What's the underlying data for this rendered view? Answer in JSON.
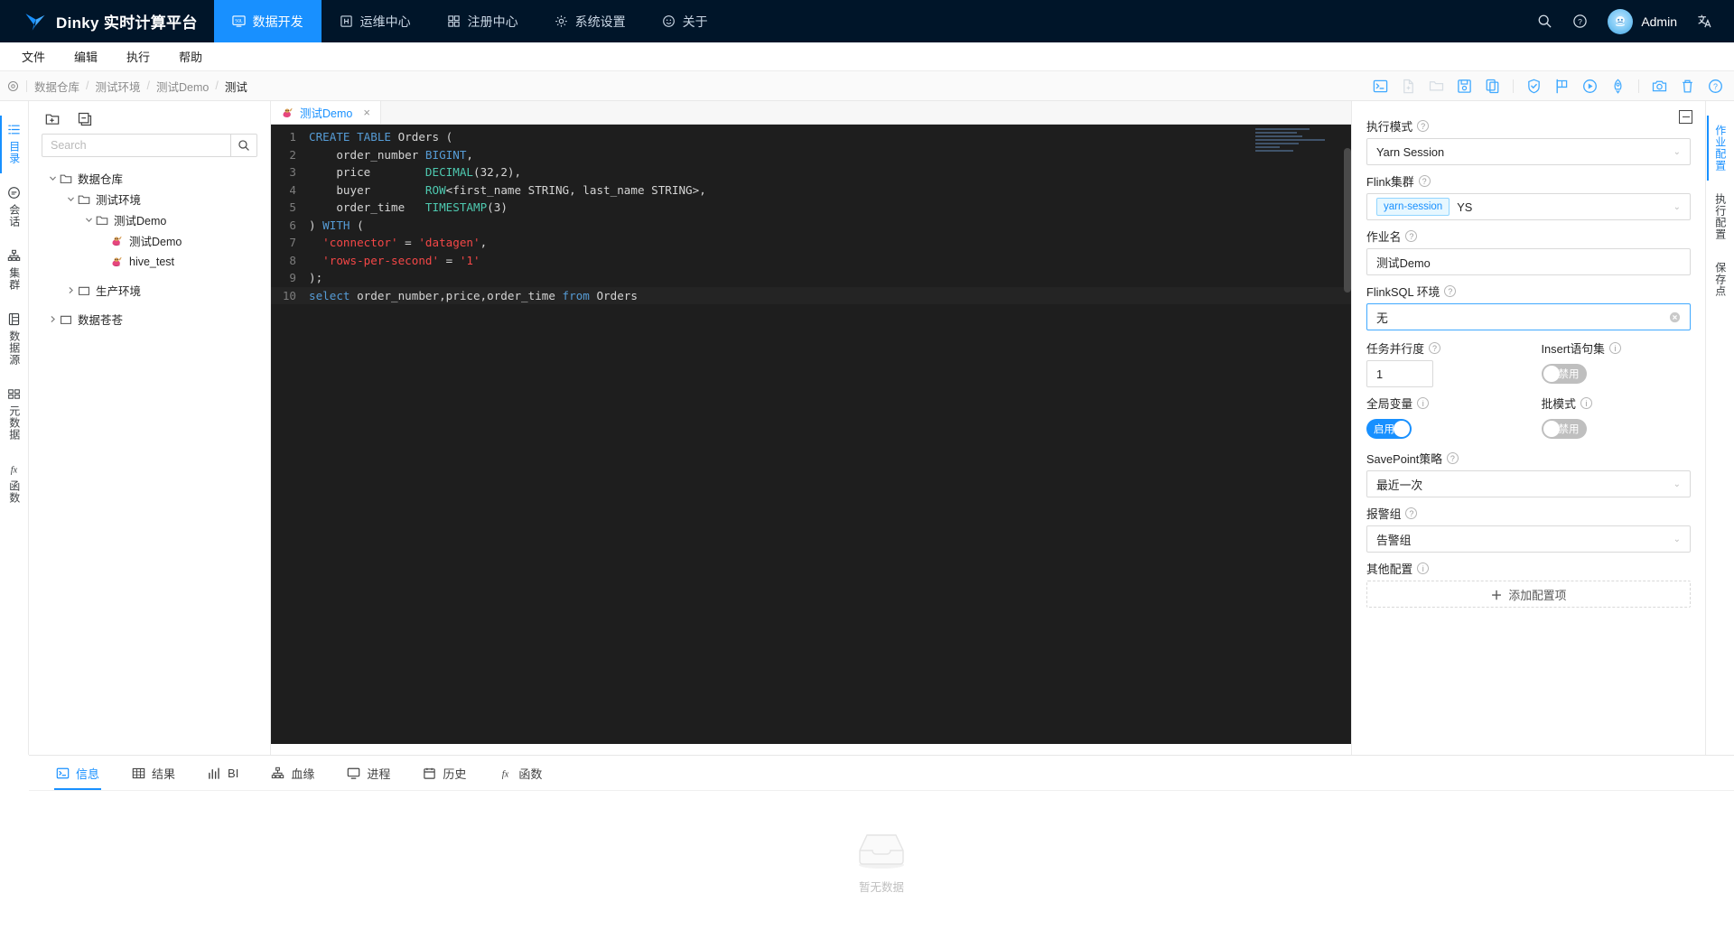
{
  "topnav": {
    "brand": "Dinky 实时计算平台",
    "items": [
      {
        "label": "数据开发",
        "icon": "sql-screen-icon",
        "active": true
      },
      {
        "label": "运维中心",
        "icon": "ops-icon",
        "active": false
      },
      {
        "label": "注册中心",
        "icon": "registry-icon",
        "active": false
      },
      {
        "label": "系统设置",
        "icon": "gear-icon",
        "active": false
      },
      {
        "label": "关于",
        "icon": "smile-icon",
        "active": false
      }
    ],
    "user": "Admin",
    "right_icons": [
      "search-icon",
      "question-circle-icon",
      "translate-icon"
    ],
    "accent": "#1890ff",
    "background": "#001529"
  },
  "menubar": {
    "items": [
      "文件",
      "编辑",
      "执行",
      "帮助"
    ]
  },
  "breadcrumb": {
    "target_icon": "target-icon",
    "path": [
      "数据仓库",
      "测试环境",
      "测试Demo",
      "测试"
    ],
    "separator": "/"
  },
  "toolbar": {
    "buttons": [
      {
        "name": "console-icon",
        "enabled": true
      },
      {
        "name": "new-file-icon",
        "enabled": false
      },
      {
        "name": "open-folder-icon",
        "enabled": false
      },
      {
        "name": "save-icon",
        "enabled": true
      },
      {
        "name": "copy-icon",
        "enabled": true
      },
      {
        "name": "check-shield-icon",
        "enabled": true
      },
      {
        "name": "flag-icon",
        "enabled": true
      },
      {
        "name": "play-circle-icon",
        "enabled": true
      },
      {
        "name": "rocket-icon",
        "enabled": true
      },
      {
        "name": "camera-icon",
        "enabled": true
      },
      {
        "name": "trash-icon",
        "enabled": true
      },
      {
        "name": "help-circle-icon",
        "enabled": true
      }
    ]
  },
  "left_rail": {
    "items": [
      {
        "label": "目录",
        "icon": "list-icon",
        "active": true
      },
      {
        "label": "会话",
        "icon": "chat-icon",
        "active": false
      },
      {
        "label": "集群",
        "icon": "cluster-icon",
        "active": false
      },
      {
        "label": "数据源",
        "icon": "database-icon",
        "active": false
      },
      {
        "label": "元数据",
        "icon": "metadata-icon",
        "active": false
      },
      {
        "label": "函数",
        "icon": "function-icon",
        "active": false
      }
    ]
  },
  "tree_panel": {
    "tools": [
      "new-folder-icon",
      "collapse-all-icon"
    ],
    "search_placeholder": "Search",
    "search_value": "",
    "nodes": [
      {
        "label": "数据仓库",
        "depth": 0,
        "caret": "down",
        "icon": "folder-icon"
      },
      {
        "label": "测试环境",
        "depth": 1,
        "caret": "down",
        "icon": "folder-icon"
      },
      {
        "label": "测试Demo",
        "depth": 2,
        "caret": "down",
        "icon": "folder-icon"
      },
      {
        "label": "测试Demo",
        "depth": 3,
        "caret": "none",
        "icon": "flink-task-icon"
      },
      {
        "label": "hive_test",
        "depth": 3,
        "caret": "none",
        "icon": "flink-task-icon"
      },
      {
        "label": "生产环境",
        "depth": 1,
        "caret": "right",
        "icon": "folder-icon"
      },
      {
        "label": "数据苍苍",
        "depth": 0,
        "caret": "right",
        "icon": "folder-icon"
      }
    ]
  },
  "editor": {
    "tab": {
      "label": "测试Demo",
      "icon": "flink-task-icon",
      "close": "×"
    },
    "lines": [
      {
        "no": "1",
        "tokens": [
          {
            "t": "CREATE TABLE ",
            "c": "k"
          },
          {
            "t": "Orders (",
            "c": ""
          }
        ]
      },
      {
        "no": "2",
        "tokens": [
          {
            "t": "    order_number ",
            "c": ""
          },
          {
            "t": "BIGINT",
            "c": "k"
          },
          {
            "t": ",",
            "c": ""
          }
        ]
      },
      {
        "no": "3",
        "tokens": [
          {
            "t": "    price        ",
            "c": ""
          },
          {
            "t": "DECIMAL",
            "c": "t"
          },
          {
            "t": "(32,2),",
            "c": ""
          }
        ]
      },
      {
        "no": "4",
        "tokens": [
          {
            "t": "    buyer        ",
            "c": ""
          },
          {
            "t": "ROW",
            "c": "t"
          },
          {
            "t": "<first_name STRING, last_name STRING>,",
            "c": ""
          }
        ]
      },
      {
        "no": "5",
        "tokens": [
          {
            "t": "    order_time   ",
            "c": ""
          },
          {
            "t": "TIMESTAMP",
            "c": "t"
          },
          {
            "t": "(3)",
            "c": ""
          }
        ]
      },
      {
        "no": "6",
        "tokens": [
          {
            "t": ") ",
            "c": ""
          },
          {
            "t": "WITH",
            "c": "k"
          },
          {
            "t": " (",
            "c": ""
          }
        ]
      },
      {
        "no": "7",
        "tokens": [
          {
            "t": "  ",
            "c": ""
          },
          {
            "t": "'connector'",
            "c": "r"
          },
          {
            "t": " = ",
            "c": ""
          },
          {
            "t": "'datagen'",
            "c": "r"
          },
          {
            "t": ",",
            "c": ""
          }
        ]
      },
      {
        "no": "8",
        "tokens": [
          {
            "t": "  ",
            "c": ""
          },
          {
            "t": "'rows-per-second'",
            "c": "r"
          },
          {
            "t": " = ",
            "c": ""
          },
          {
            "t": "'1'",
            "c": "r"
          }
        ]
      },
      {
        "no": "9",
        "tokens": [
          {
            "t": ");",
            "c": ""
          }
        ]
      },
      {
        "no": "10",
        "tokens": [
          {
            "t": "select",
            "c": "k"
          },
          {
            "t": " order_number,price,order_time ",
            "c": ""
          },
          {
            "t": "from",
            "c": "k"
          },
          {
            "t": " Orders",
            "c": ""
          }
        ]
      }
    ]
  },
  "config": {
    "fields": {
      "exec_mode_label": "执行模式",
      "exec_mode_value": "Yarn Session",
      "cluster_label": "Flink集群",
      "cluster_tag": "yarn-session",
      "cluster_value": "YS",
      "job_name_label": "作业名",
      "job_name_value": "测试Demo",
      "flinksql_env_label": "FlinkSQL 环境",
      "flinksql_env_value": "无",
      "parallelism_label": "任务并行度",
      "parallelism_value": "1",
      "insert_set_label": "Insert语句集",
      "insert_set_state": "禁用",
      "global_var_label": "全局变量",
      "global_var_state": "启用",
      "batch_mode_label": "批模式",
      "batch_mode_state": "禁用",
      "savepoint_label": "SavePoint策略",
      "savepoint_value": "最近一次",
      "alert_group_label": "报警组",
      "alert_group_value": "告警组",
      "other_config_label": "其他配置",
      "add_config_label": "添加配置项"
    }
  },
  "right_rail": {
    "items": [
      {
        "label": "作业配置",
        "active": true
      },
      {
        "label": "执行配置",
        "active": false
      },
      {
        "label": "保存点",
        "active": false
      }
    ]
  },
  "bottom": {
    "tabs": [
      {
        "label": "信息",
        "icon": "console-icon",
        "active": true
      },
      {
        "label": "结果",
        "icon": "table-icon",
        "active": false
      },
      {
        "label": "BI",
        "icon": "chart-icon",
        "active": false
      },
      {
        "label": "血缘",
        "icon": "lineage-icon",
        "active": false
      },
      {
        "label": "进程",
        "icon": "monitor-icon",
        "active": false
      },
      {
        "label": "历史",
        "icon": "history-icon",
        "active": false
      },
      {
        "label": "函数",
        "icon": "function-icon",
        "active": false
      }
    ],
    "empty_text": "暂无数据",
    "empty_icon": "empty-box-icon"
  }
}
